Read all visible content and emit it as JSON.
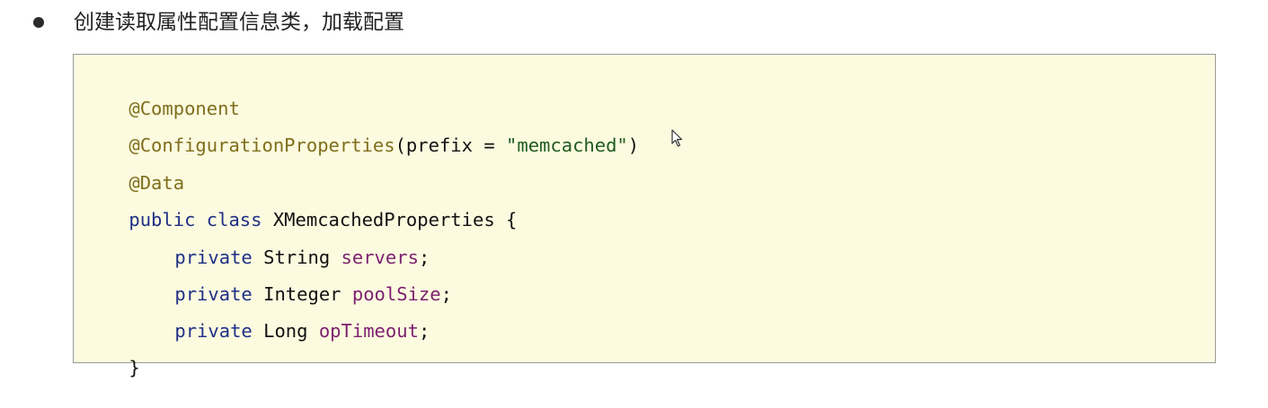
{
  "bullet_text": "创建读取属性配置信息类，加载配置",
  "code": {
    "line1": {
      "anno": "@Component"
    },
    "line2": {
      "anno": "@ConfigurationProperties",
      "p1": "(prefix = ",
      "str": "\"memcached\"",
      "p2": ")"
    },
    "line3": {
      "anno": "@Data"
    },
    "line4": {
      "kw": "public class",
      "p1": " XMemcachedProperties {"
    },
    "line5": {
      "kw": "private",
      "type": " String ",
      "field": "servers",
      "end": ";"
    },
    "line6": {
      "kw": "private",
      "type": " Integer ",
      "field": "poolSize",
      "end": ";"
    },
    "line7": {
      "kw": "private",
      "type": " Long ",
      "field": "opTimeout",
      "end": ";"
    },
    "line8": {
      "p1": "}"
    }
  },
  "colors": {
    "annotation": "#7f6e1c",
    "keyword": "#1f2f86",
    "string": "#1f5a1f",
    "field": "#7b1f6e",
    "code_background": "#fcfbe0"
  },
  "icons": {
    "cursor": "mouse-pointer-icon"
  }
}
